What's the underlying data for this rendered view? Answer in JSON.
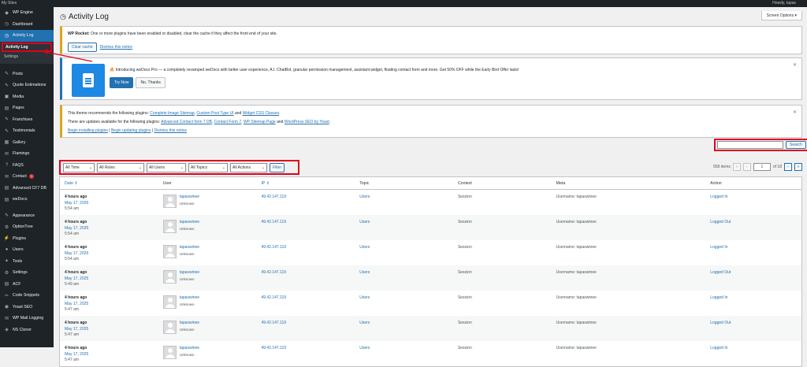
{
  "topbar": {
    "left_items": [
      "My Sites"
    ],
    "right_text": "Howdy, tapas"
  },
  "sidebar": {
    "items": [
      {
        "label": "WP Engine",
        "icon": "wp-engine-icon",
        "glyph": "◆"
      },
      {
        "label": "Dashboard",
        "icon": "dashboard-icon",
        "glyph": "◷"
      },
      {
        "label": "Activity Log",
        "icon": "activity-log-icon",
        "glyph": "◷",
        "current": true
      }
    ],
    "submenu": [
      {
        "label": "Activity Log",
        "current": true
      },
      {
        "label": "Settings",
        "current": false
      }
    ],
    "items2": [
      {
        "label": "Posts",
        "icon": "pin-icon",
        "glyph": "✎"
      },
      {
        "label": "Quote Estimations",
        "icon": "quote-icon",
        "glyph": "✎"
      },
      {
        "label": "Media",
        "icon": "media-icon",
        "glyph": "▣"
      },
      {
        "label": "Pages",
        "icon": "pages-icon",
        "glyph": "▤"
      },
      {
        "label": "Franchises",
        "icon": "franchises-icon",
        "glyph": "✎"
      },
      {
        "label": "Testimonials",
        "icon": "testimonials-icon",
        "glyph": "✎"
      },
      {
        "label": "Gallery",
        "icon": "gallery-icon",
        "glyph": "▦"
      },
      {
        "label": "Flamingo",
        "icon": "flamingo-icon",
        "glyph": "✉"
      },
      {
        "label": "FAQS",
        "icon": "faqs-icon",
        "glyph": "?"
      },
      {
        "label": "Contact",
        "icon": "contact-icon",
        "glyph": "✉",
        "badge": "1"
      },
      {
        "label": "Advanced CF7 DB",
        "icon": "database-icon",
        "glyph": "▤"
      },
      {
        "label": "weDocs",
        "icon": "wedocs-icon",
        "glyph": "▤"
      }
    ],
    "items3": [
      {
        "label": "Appearance",
        "icon": "appearance-icon",
        "glyph": "✎"
      },
      {
        "label": "OptionTree",
        "icon": "optiontree-icon",
        "glyph": "⚙"
      },
      {
        "label": "Plugins",
        "icon": "plugins-icon",
        "glyph": "⚡"
      },
      {
        "label": "Users",
        "icon": "users-icon",
        "glyph": "●"
      },
      {
        "label": "Tools",
        "icon": "tools-icon",
        "glyph": "✦"
      },
      {
        "label": "Settings",
        "icon": "settings-icon",
        "glyph": "⚙"
      },
      {
        "label": "ACF",
        "icon": "acf-icon",
        "glyph": "▤"
      },
      {
        "label": "Code Snippets",
        "icon": "code-snippets-icon",
        "glyph": "✂"
      },
      {
        "label": "Yoast SEO",
        "icon": "yoast-icon",
        "glyph": "◉"
      },
      {
        "label": "WP Mail Logging",
        "icon": "mail-logging-icon",
        "glyph": "✉"
      },
      {
        "label": "NS Cloner",
        "icon": "ns-cloner-icon",
        "glyph": "◈"
      }
    ]
  },
  "header": {
    "title": "Activity Log",
    "screen_options": "Screen Options ▾"
  },
  "notice_rocket": {
    "text_bold": "WP Rocket:",
    "text": " One or more plugins have been enabled or disabled, clear the cache if they affect the front end of your site.",
    "clear_cache": "Clear cache",
    "dismiss": "Dismiss this notice"
  },
  "notice_wedocs": {
    "text": "Introducing weDocs Pro — a completely revamped weDocs with better user experience, A.I. ChatBot, granular permission management, assistant widget, floating contact form and more. Get 50% OFF while the Early Bird Offer lasts!",
    "try_now": "Try Now",
    "no_thanks": "No, Thanks"
  },
  "notice_theme": {
    "line1_pre": "This theme recommends the following plugins: ",
    "line1_links": [
      "Complete Image Sitemap",
      "Custom Post Type UI",
      "Widget CSS Classes"
    ],
    "line2_pre": "There are updates available for the following plugins: ",
    "line2_links": [
      "Advanced Contact form 7 DB",
      "Contact Form 7",
      "WP Sitemap Page",
      "WordPress SEO by Yoast"
    ],
    "line3": [
      "Begin installing plugins",
      "Begin updating plugins",
      "Dismiss this notice"
    ]
  },
  "search": {
    "value": "",
    "button": "Search"
  },
  "filters": {
    "time": "All Time",
    "roles": "All Roles",
    "users": "All Users",
    "topics": "All Topics",
    "actions": "All Actions",
    "filter_button": "Filter"
  },
  "pagination": {
    "items": "556 items",
    "first": "«",
    "prev": "‹",
    "current": "1",
    "of": "of 18",
    "next": "›",
    "last": "»"
  },
  "table": {
    "columns": [
      "Date",
      "User",
      "IP",
      "Topic",
      "Context",
      "Meta",
      "Action"
    ],
    "rows": [
      {
        "ago": "4 hours ago",
        "date": "May 17, 2025",
        "time": "5:54 am",
        "user": "tapaswinee",
        "role": "Unknown",
        "ip": "49.42.147.119",
        "topic": "Users",
        "context": "Session",
        "meta": "Username: tapaswinee",
        "action": "Logged In"
      },
      {
        "ago": "4 hours ago",
        "date": "May 17, 2025",
        "time": "5:54 am",
        "user": "tapaswinee",
        "role": "Unknown",
        "ip": "49.42.147.119",
        "topic": "Users",
        "context": "Session",
        "meta": "Username: tapaswinee",
        "action": "Logged Out"
      },
      {
        "ago": "4 hours ago",
        "date": "May 17, 2025",
        "time": "5:54 am",
        "user": "tapaswinee",
        "role": "Unknown",
        "ip": "49.42.147.119",
        "topic": "Users",
        "context": "Session",
        "meta": "Username: tapaswinee",
        "action": "Logged In"
      },
      {
        "ago": "4 hours ago",
        "date": "May 17, 2025",
        "time": "5:49 am",
        "user": "tapaswinee",
        "role": "Unknown",
        "ip": "49.42.147.119",
        "topic": "Users",
        "context": "Session",
        "meta": "Username: tapaswinee",
        "action": "Logged Out"
      },
      {
        "ago": "4 hours ago",
        "date": "May 17, 2025",
        "time": "5:47 am",
        "user": "tapaswinee",
        "role": "Unknown",
        "ip": "49.42.147.119",
        "topic": "Users",
        "context": "Session",
        "meta": "Username: tapaswinee",
        "action": "Logged In"
      },
      {
        "ago": "4 hours ago",
        "date": "May 17, 2025",
        "time": "5:47 am",
        "user": "tapaswinee",
        "role": "Unknown",
        "ip": "49.42.147.119",
        "topic": "Users",
        "context": "Session",
        "meta": "Username: tapaswinee",
        "action": "Logged Out"
      },
      {
        "ago": "4 hours ago",
        "date": "May 17, 2025",
        "time": "5:47 am",
        "user": "tapaswinee",
        "role": "Unknown",
        "ip": "49.42.147.119",
        "topic": "Users",
        "context": "Session",
        "meta": "Username: tapaswinee",
        "action": "Logged In"
      }
    ]
  },
  "colors": {
    "accent": "#2271b1",
    "sidebar": "#1d2327",
    "highlight": "#e0001b",
    "warning": "#dba617"
  }
}
